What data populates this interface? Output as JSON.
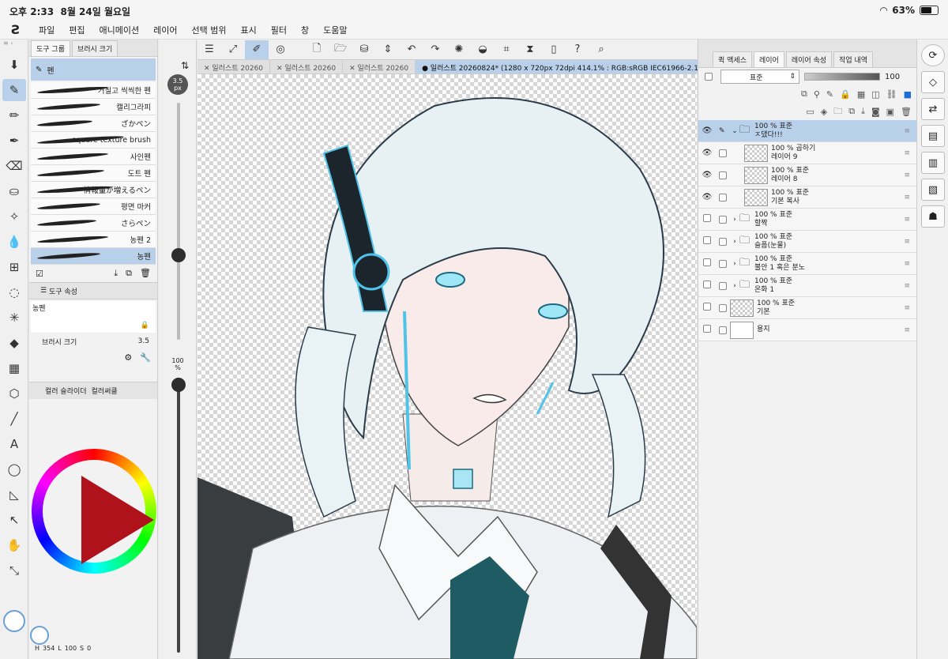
{
  "status": {
    "time": "오후 2:33",
    "date": "8월 24일 월요일",
    "battery": "63%",
    "battery_level": 0.63
  },
  "menu": [
    "파일",
    "편집",
    "애니메이션",
    "레이어",
    "선택 범위",
    "표시",
    "필터",
    "창",
    "도움말"
  ],
  "subtool": {
    "tab_tool_group": "도구 그룹",
    "tab_brush_size": "브러시 크기",
    "group_name": "펜",
    "brushes": [
      "거칠고 씩씩한 펜",
      "캘리그라피",
      "ざかペン",
      "square texture brush",
      "사인펜",
      "도트 펜",
      "情報量が増えるペン",
      "평면 마커",
      "さらペン",
      "농펜 2",
      "농펜"
    ],
    "props_title": "도구 속성",
    "preview_label": "농펜",
    "brush_size_label": "브러시 크기",
    "brush_size_value": "3.5"
  },
  "color_panel": {
    "tab_slider": "컬러 슬라이더",
    "tab_circle": "컬러써클",
    "primary_color": "#ffffff",
    "hue_color": "#b0121c"
  },
  "footer": {
    "h_label": "H",
    "h_value": "354",
    "l_label": "L",
    "l_value": "100",
    "s_label": "S",
    "s_value": "0"
  },
  "sizebar": {
    "size": "3.5",
    "size_unit": "px",
    "opacity": "100",
    "opacity_unit": "%"
  },
  "doc_tabs": [
    "일러스트 20260",
    "일러스트 20260",
    "일러스트 20260",
    "● 일러스트 20260824* (1280 x 720px 72dpi 414.1% : RGB:sRGB IEC61966-2.1)"
  ],
  "layer_panel": {
    "tabs": [
      "퀵 액세스",
      "레이어",
      "레이어 속성",
      "작업 내역"
    ],
    "blend": "표준",
    "opacity": "100",
    "layers": [
      {
        "mode": "100 % 표준",
        "name": "ㅈ댔다!!!",
        "type": "folder",
        "visible": true,
        "selected": true,
        "indent": 0
      },
      {
        "mode": "100 % 곱하기",
        "name": "레이어 9",
        "type": "raster",
        "visible": true,
        "selected": false,
        "indent": 1
      },
      {
        "mode": "100 % 표준",
        "name": "레이어 8",
        "type": "raster",
        "visible": true,
        "selected": false,
        "indent": 1
      },
      {
        "mode": "100 % 표준",
        "name": "기본 복사",
        "type": "raster",
        "visible": true,
        "selected": false,
        "indent": 1
      },
      {
        "mode": "100 % 표준",
        "name": "할짝",
        "type": "folder",
        "visible": false,
        "selected": false,
        "indent": 0
      },
      {
        "mode": "100 % 표준",
        "name": "슬픔(눈물)",
        "type": "folder",
        "visible": false,
        "selected": false,
        "indent": 0
      },
      {
        "mode": "100 % 표준",
        "name": "불안 1 혹은 분노",
        "type": "folder",
        "visible": false,
        "selected": false,
        "indent": 0
      },
      {
        "mode": "100 % 표준",
        "name": "온화 1",
        "type": "folder",
        "visible": false,
        "selected": false,
        "indent": 0
      },
      {
        "mode": "100 % 표준",
        "name": "기본",
        "type": "raster",
        "visible": false,
        "selected": false,
        "indent": 0
      },
      {
        "mode": "",
        "name": "용지",
        "type": "paper",
        "visible": false,
        "selected": false,
        "indent": 0
      }
    ]
  }
}
